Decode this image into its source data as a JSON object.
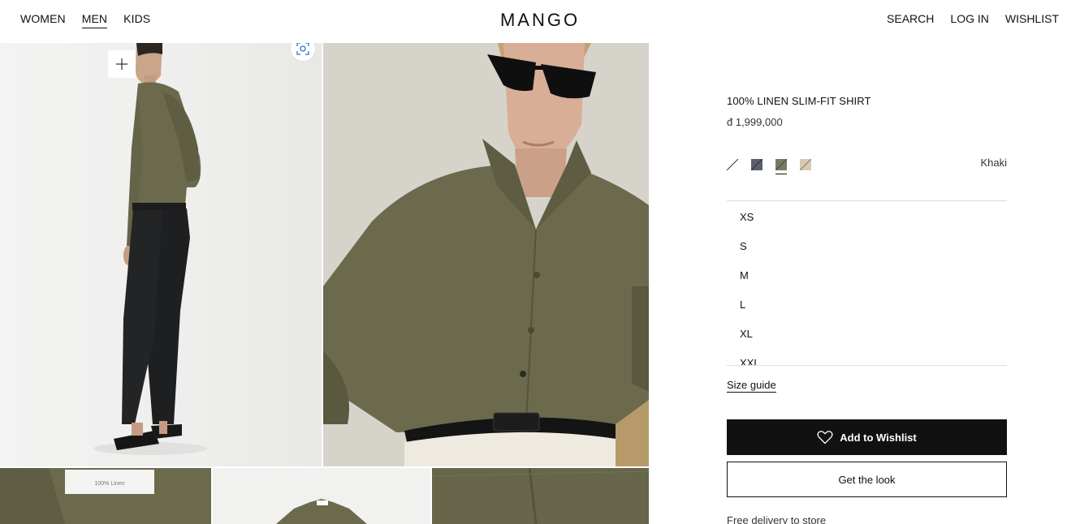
{
  "header": {
    "nav_left": [
      "WOMEN",
      "MEN",
      "KIDS"
    ],
    "active_nav": "MEN",
    "logo": "MANGO",
    "nav_right": [
      "SEARCH",
      "LOG IN",
      "WISHLIST"
    ]
  },
  "gallery": {
    "zoom_icon": "plus-icon",
    "visual_search_icon": "lens-icon",
    "label_tag_text": "100% Linen"
  },
  "product": {
    "title": "100% LINEN SLIM-FIT SHIRT",
    "price": "đ 1,999,000",
    "color_name": "Khaki",
    "swatches": [
      {
        "name": "white",
        "color": "#ffffff"
      },
      {
        "name": "navy",
        "color": "#5b5f6b"
      },
      {
        "name": "khaki",
        "color": "#7b7a62",
        "selected": true
      },
      {
        "name": "beige",
        "color": "#d9c8b3"
      }
    ],
    "sizes": [
      "XS",
      "S",
      "M",
      "L",
      "XL",
      "XXL"
    ],
    "size_guide": "Size guide",
    "add_to_wishlist": "Add to Wishlist",
    "get_the_look": "Get the look",
    "delivery": "Free delivery to store"
  },
  "colors": {
    "primary": "#111111",
    "khaki": "#6b6a4d"
  }
}
